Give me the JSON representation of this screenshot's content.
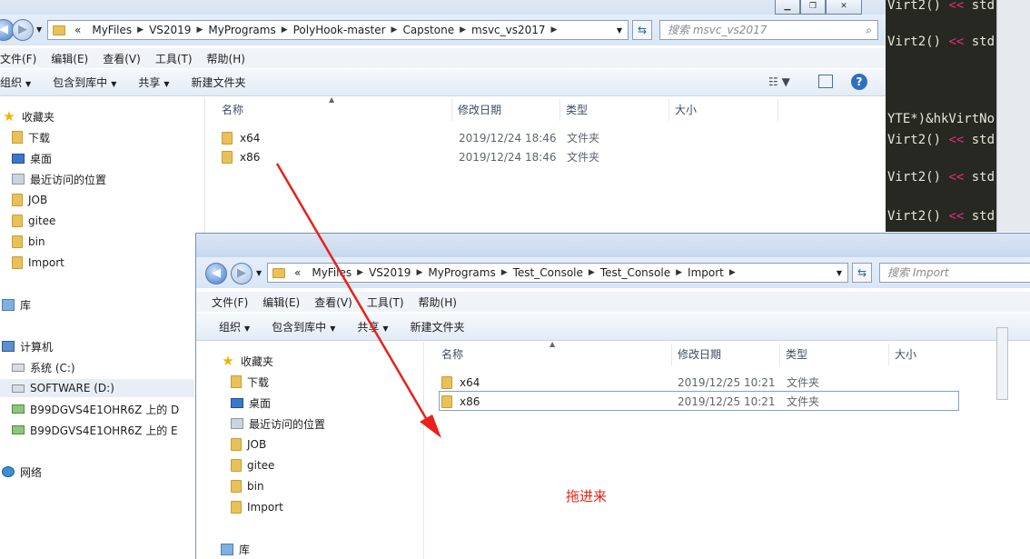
{
  "back_window": {
    "breadcrumb": [
      "«",
      "MyFiles",
      "VS2019",
      "MyPrograms",
      "PolyHook-master",
      "Capstone",
      "msvc_vs2017"
    ],
    "search_placeholder": "搜索 msvc_vs2017",
    "menu": [
      "文件(F)",
      "编辑(E)",
      "查看(V)",
      "工具(T)",
      "帮助(H)"
    ],
    "toolbar": {
      "organize": "组织",
      "include_in_library": "包含到库中",
      "share": "共享",
      "new_folder": "新建文件夹"
    },
    "nav": {
      "favorites": "收藏夹",
      "downloads": "下载",
      "desktop": "桌面",
      "recent": "最近访问的位置",
      "job": "JOB",
      "gitee": "gitee",
      "bin": "bin",
      "import": "Import",
      "libraries": "库",
      "computer": "计算机",
      "drive_c": "系统 (C:)",
      "drive_d": "SOFTWARE (D:)",
      "net_d": "B99DGVS4E1OHR6Z 上的 D",
      "net_e": "B99DGVS4E1OHR6Z 上的 E",
      "network": "网络"
    },
    "columns": {
      "name": "名称",
      "modified": "修改日期",
      "type": "类型",
      "size": "大小"
    },
    "files": [
      {
        "name": "x64",
        "modified": "2019/12/24 18:46",
        "type": "文件夹"
      },
      {
        "name": "x86",
        "modified": "2019/12/24 18:46",
        "type": "文件夹"
      }
    ]
  },
  "front_window": {
    "breadcrumb": [
      "«",
      "MyFiles",
      "VS2019",
      "MyPrograms",
      "Test_Console",
      "Test_Console",
      "Import"
    ],
    "search_placeholder": "搜索 Import",
    "menu": [
      "文件(F)",
      "编辑(E)",
      "查看(V)",
      "工具(T)",
      "帮助(H)"
    ],
    "toolbar": {
      "organize": "组织",
      "include_in_library": "包含到库中",
      "share": "共享",
      "new_folder": "新建文件夹"
    },
    "nav": {
      "favorites": "收藏夹",
      "downloads": "下载",
      "desktop": "桌面",
      "recent": "最近访问的位置",
      "job": "JOB",
      "gitee": "gitee",
      "bin": "bin",
      "import": "Import",
      "libraries": "库"
    },
    "columns": {
      "name": "名称",
      "modified": "修改日期",
      "type": "类型",
      "size": "大小"
    },
    "files": [
      {
        "name": "x64",
        "modified": "2019/12/25 10:21",
        "type": "文件夹"
      },
      {
        "name": "x86",
        "modified": "2019/12/25 10:21",
        "type": "文件夹"
      }
    ]
  },
  "editor": {
    "lines": [
      {
        "pre": "Virt2() ",
        "op": "<<",
        "post": " std"
      },
      {
        "pre": "Virt2() ",
        "op": "<<",
        "post": " std"
      },
      {
        "pre": "YTE*)&hkVirtNo",
        "op": "",
        "post": ""
      },
      {
        "pre": "Virt2() ",
        "op": "<<",
        "post": " std"
      },
      {
        "pre": "Virt2() ",
        "op": "<<",
        "post": " std"
      },
      {
        "pre": "Virt2() ",
        "op": "<<",
        "post": " std"
      }
    ]
  },
  "annotation": {
    "text": "拖进来",
    "color": "#e8211a"
  }
}
